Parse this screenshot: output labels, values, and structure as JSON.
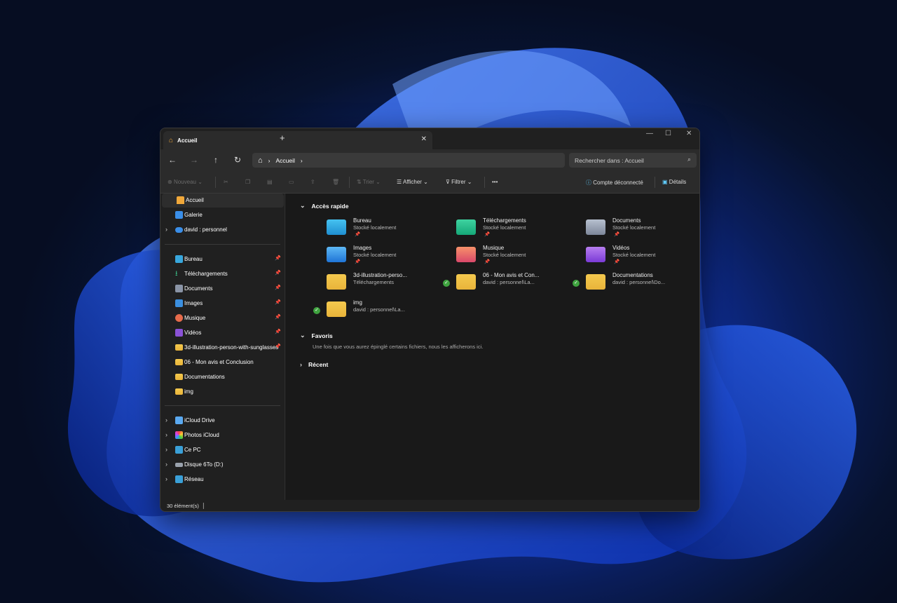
{
  "window": {
    "tab_title": "Accueil",
    "new_tab": "+",
    "minimize": "—",
    "maximize": "☐",
    "close": "✕",
    "tab_close": "✕"
  },
  "nav": {
    "back": "←",
    "forward": "→",
    "up": "↑",
    "refresh": "↻",
    "home_icon": "home-icon",
    "breadcrumb_sep": "›",
    "breadcrumb": "Accueil",
    "breadcrumb_more": "›",
    "search_placeholder": "Rechercher dans : Accueil"
  },
  "toolbar": {
    "new": "Nouveau",
    "sort": "Trier",
    "view": "Afficher",
    "filter": "Filtrer",
    "more": "•••",
    "account": "Compte déconnecté",
    "details": "Détails"
  },
  "sidebar": {
    "top": [
      {
        "label": "Accueil"
      },
      {
        "label": "Galerie"
      },
      {
        "label": "david : personnel"
      }
    ],
    "pinned": [
      {
        "label": "Bureau"
      },
      {
        "label": "Téléchargements"
      },
      {
        "label": "Documents"
      },
      {
        "label": "Images"
      },
      {
        "label": "Musique"
      },
      {
        "label": "Vidéos"
      },
      {
        "label": "3d-illustration-person-with-sunglasses"
      },
      {
        "label": "06 - Mon avis et Conclusion"
      },
      {
        "label": "Documentations"
      },
      {
        "label": "img"
      }
    ],
    "drives": [
      {
        "label": "iCloud Drive"
      },
      {
        "label": "Photos iCloud"
      },
      {
        "label": "Ce PC"
      },
      {
        "label": "Disque 6To (D:)"
      },
      {
        "label": "Réseau"
      }
    ]
  },
  "main": {
    "quick_access_title": "Accès rapide",
    "items": [
      {
        "name": "Bureau",
        "sub": "Stocké localement"
      },
      {
        "name": "Téléchargements",
        "sub": "Stocké localement"
      },
      {
        "name": "Documents",
        "sub": "Stocké localement"
      },
      {
        "name": "Images",
        "sub": "Stocké localement"
      },
      {
        "name": "Musique",
        "sub": "Stocké localement"
      },
      {
        "name": "Vidéos",
        "sub": "Stocké localement"
      },
      {
        "name": "3d-illustration-perso...",
        "sub": "Téléchargements"
      },
      {
        "name": "06 - Mon avis et Con...",
        "sub": "david : personnel\\La..."
      },
      {
        "name": "Documentations",
        "sub": "david : personnel\\Do..."
      },
      {
        "name": "img",
        "sub": "david : personnel\\La..."
      }
    ],
    "favorites_title": "Favoris",
    "favorites_empty": "Une fois que vous aurez épinglé certains fichiers, nous les afficherons ici.",
    "recent_title": "Récent"
  },
  "status": {
    "count": "30 élément(s)"
  },
  "colors": {
    "accent": "#60cdff",
    "folder": "#f4c94e",
    "sync_ok": "#3fa33f"
  }
}
